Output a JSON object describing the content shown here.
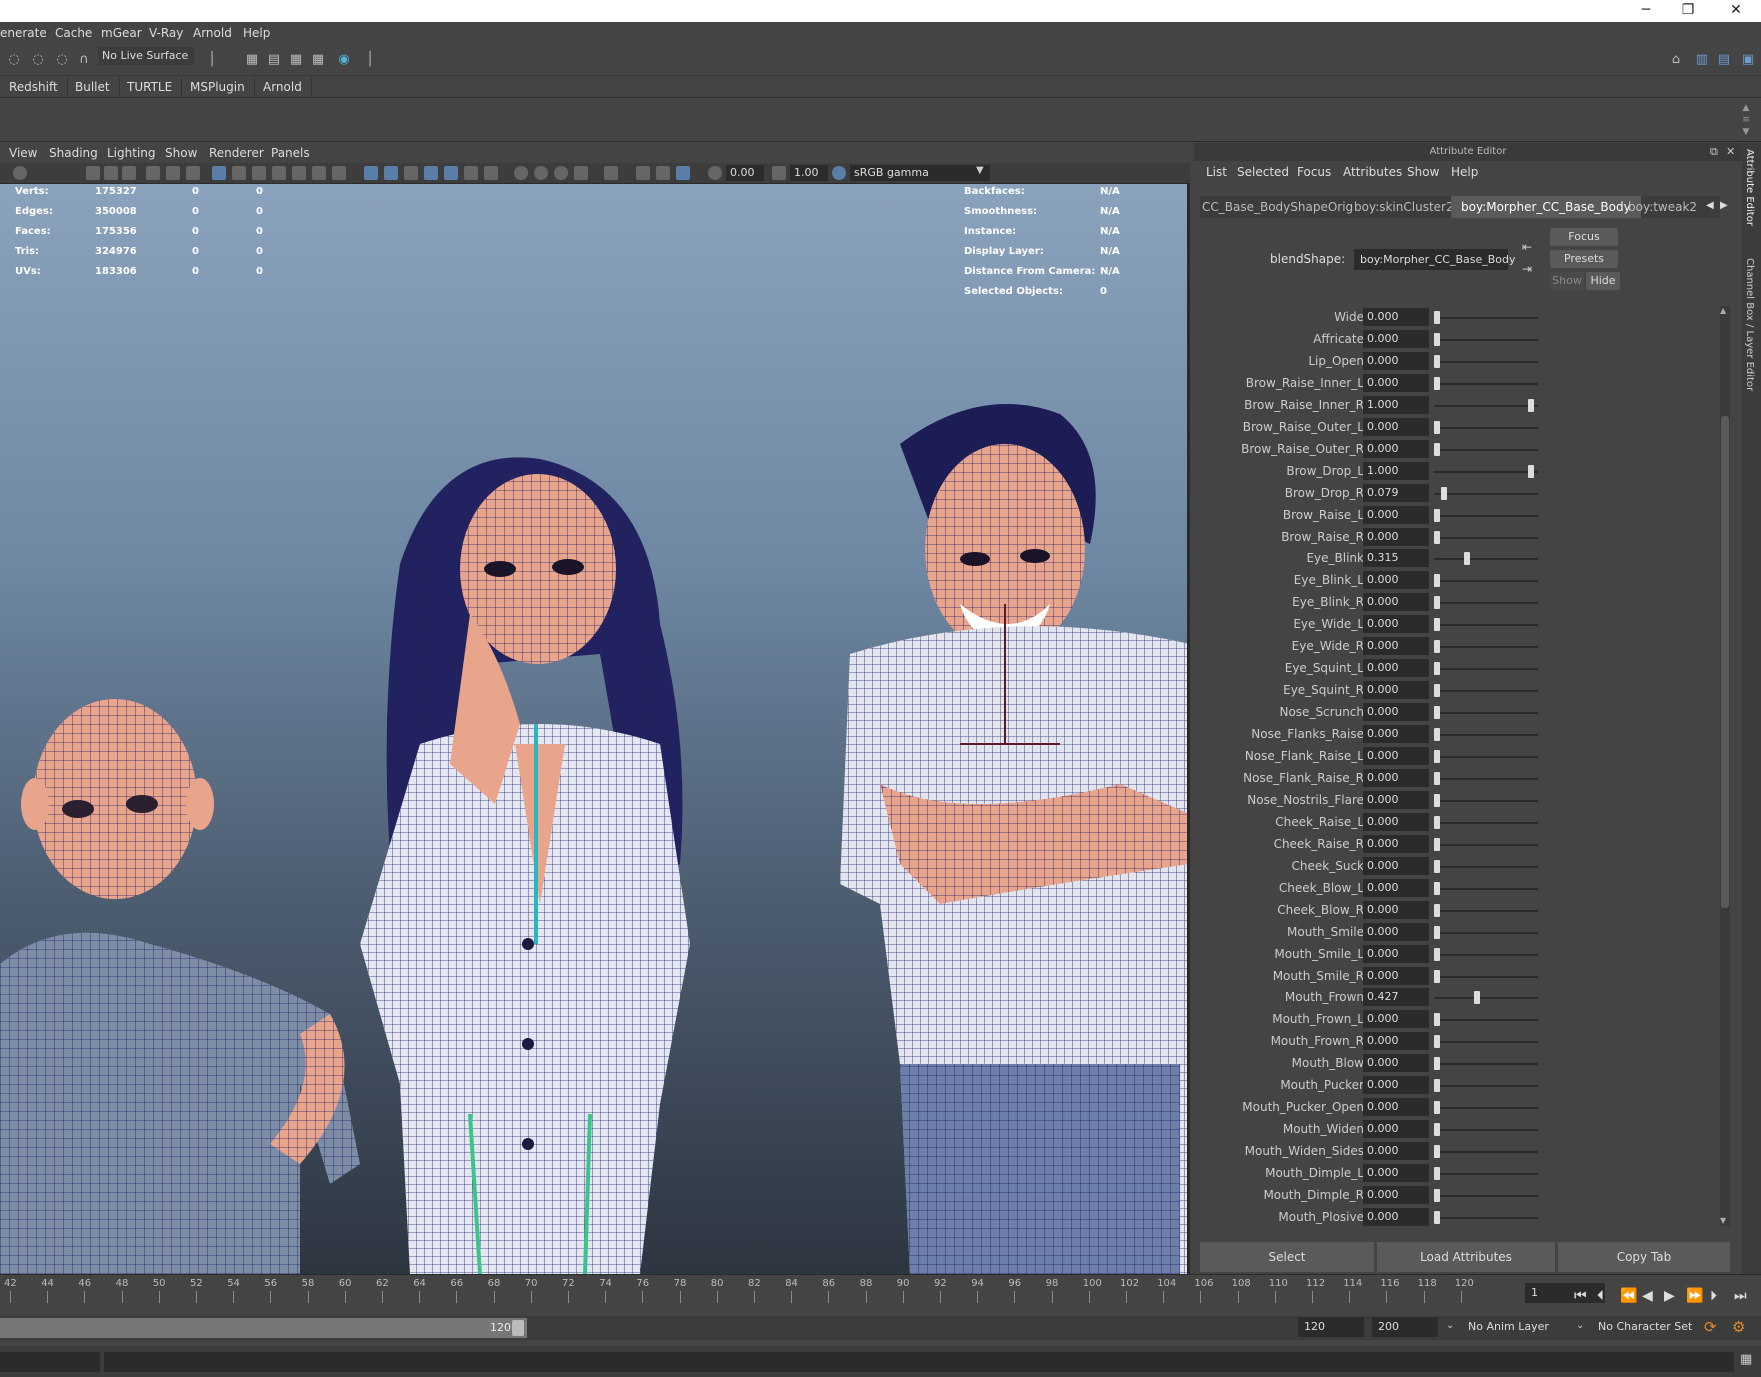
{
  "menu": [
    "enerate",
    "Cache",
    "mGear",
    "V-Ray",
    "Arnold",
    "Help"
  ],
  "toolbar": {
    "live_surface": "No Live Surface"
  },
  "shelf_tabs": [
    "Redshift",
    "Bullet",
    "TURTLE",
    "MSPlugin",
    "Arnold"
  ],
  "viewport": {
    "menu": [
      "View",
      "Shading",
      "Lighting",
      "Show",
      "Renderer",
      "Panels"
    ],
    "exposure": "0.00",
    "gamma": "1.00",
    "color_space": "sRGB gamma"
  },
  "hud_left": [
    {
      "label": "Verts:",
      "v1": "175327",
      "v2": "0",
      "v3": "0"
    },
    {
      "label": "Edges:",
      "v1": "350008",
      "v2": "0",
      "v3": "0"
    },
    {
      "label": "Faces:",
      "v1": "175356",
      "v2": "0",
      "v3": "0"
    },
    {
      "label": "Tris:",
      "v1": "324976",
      "v2": "0",
      "v3": "0"
    },
    {
      "label": "UVs:",
      "v1": "183306",
      "v2": "0",
      "v3": "0"
    }
  ],
  "hud_right": [
    {
      "label": "Backfaces:",
      "value": "N/A"
    },
    {
      "label": "Smoothness:",
      "value": "N/A"
    },
    {
      "label": "Instance:",
      "value": "N/A"
    },
    {
      "label": "Display Layer:",
      "value": "N/A"
    },
    {
      "label": "Distance From Camera:",
      "value": "N/A"
    },
    {
      "label": "Selected Objects:",
      "value": "0"
    }
  ],
  "attr_editor": {
    "title": "Attribute Editor",
    "menu": [
      "List",
      "Selected",
      "Focus",
      "Attributes",
      "Show",
      "Help"
    ],
    "tabs": [
      "CC_Base_BodyShapeOrig",
      "boy:skinCluster2",
      "boy:Morpher_CC_Base_Body",
      "boy:tweak2"
    ],
    "blendshape_label": "blendShape:",
    "blendshape_value": "boy:Morpher_CC_Base_Body",
    "focus": "Focus",
    "presets": "Presets",
    "show": "Show",
    "hide": "Hide",
    "select": "Select",
    "load_attributes": "Load Attributes",
    "copy_tab": "Copy Tab"
  },
  "attributes": [
    {
      "name": "Wide",
      "value": "0.000",
      "level": 0
    },
    {
      "name": "Affricate",
      "value": "0.000",
      "level": 0
    },
    {
      "name": "Lip_Open",
      "value": "0.000",
      "level": 0
    },
    {
      "name": "Brow_Raise_Inner_L",
      "value": "0.000",
      "level": 0
    },
    {
      "name": "Brow_Raise_Inner_R",
      "value": "1.000",
      "level": 1
    },
    {
      "name": "Brow_Raise_Outer_L",
      "value": "0.000",
      "level": 0
    },
    {
      "name": "Brow_Raise_Outer_R",
      "value": "0.000",
      "level": 0
    },
    {
      "name": "Brow_Drop_L",
      "value": "1.000",
      "level": 1
    },
    {
      "name": "Brow_Drop_R",
      "value": "0.079",
      "level": 0.079
    },
    {
      "name": "Brow_Raise_L",
      "value": "0.000",
      "level": 0
    },
    {
      "name": "Brow_Raise_R",
      "value": "0.000",
      "level": 0
    },
    {
      "name": "Eye_Blink",
      "value": "0.315",
      "level": 0.315
    },
    {
      "name": "Eye_Blink_L",
      "value": "0.000",
      "level": 0
    },
    {
      "name": "Eye_Blink_R",
      "value": "0.000",
      "level": 0
    },
    {
      "name": "Eye_Wide_L",
      "value": "0.000",
      "level": 0
    },
    {
      "name": "Eye_Wide_R",
      "value": "0.000",
      "level": 0
    },
    {
      "name": "Eye_Squint_L",
      "value": "0.000",
      "level": 0
    },
    {
      "name": "Eye_Squint_R",
      "value": "0.000",
      "level": 0
    },
    {
      "name": "Nose_Scrunch",
      "value": "0.000",
      "level": 0
    },
    {
      "name": "Nose_Flanks_Raise",
      "value": "0.000",
      "level": 0
    },
    {
      "name": "Nose_Flank_Raise_L",
      "value": "0.000",
      "level": 0
    },
    {
      "name": "Nose_Flank_Raise_R",
      "value": "0.000",
      "level": 0
    },
    {
      "name": "Nose_Nostrils_Flare",
      "value": "0.000",
      "level": 0
    },
    {
      "name": "Cheek_Raise_L",
      "value": "0.000",
      "level": 0
    },
    {
      "name": "Cheek_Raise_R",
      "value": "0.000",
      "level": 0
    },
    {
      "name": "Cheek_Suck",
      "value": "0.000",
      "level": 0
    },
    {
      "name": "Cheek_Blow_L",
      "value": "0.000",
      "level": 0
    },
    {
      "name": "Cheek_Blow_R",
      "value": "0.000",
      "level": 0
    },
    {
      "name": "Mouth_Smile",
      "value": "0.000",
      "level": 0
    },
    {
      "name": "Mouth_Smile_L",
      "value": "0.000",
      "level": 0
    },
    {
      "name": "Mouth_Smile_R",
      "value": "0.000",
      "level": 0
    },
    {
      "name": "Mouth_Frown",
      "value": "0.427",
      "level": 0.427
    },
    {
      "name": "Mouth_Frown_L",
      "value": "0.000",
      "level": 0
    },
    {
      "name": "Mouth_Frown_R",
      "value": "0.000",
      "level": 0
    },
    {
      "name": "Mouth_Blow",
      "value": "0.000",
      "level": 0
    },
    {
      "name": "Mouth_Pucker",
      "value": "0.000",
      "level": 0
    },
    {
      "name": "Mouth_Pucker_Open",
      "value": "0.000",
      "level": 0
    },
    {
      "name": "Mouth_Widen",
      "value": "0.000",
      "level": 0
    },
    {
      "name": "Mouth_Widen_Sides",
      "value": "0.000",
      "level": 0
    },
    {
      "name": "Mouth_Dimple_L",
      "value": "0.000",
      "level": 0
    },
    {
      "name": "Mouth_Dimple_R",
      "value": "0.000",
      "level": 0
    },
    {
      "name": "Mouth_Plosive",
      "value": "0.000",
      "level": 0
    }
  ],
  "side_tabs": [
    "Attribute Editor",
    "Channel Box / Layer Editor"
  ],
  "timeline": {
    "ticks": [
      "42",
      "44",
      "46",
      "48",
      "50",
      "52",
      "54",
      "56",
      "58",
      "60",
      "62",
      "64",
      "66",
      "68",
      "70",
      "72",
      "74",
      "76",
      "78",
      "80",
      "82",
      "84",
      "86",
      "88",
      "90",
      "92",
      "94",
      "96",
      "98",
      "100",
      "102",
      "104",
      "106",
      "108",
      "110",
      "112",
      "114",
      "116",
      "118",
      "120"
    ],
    "current_frame": "1"
  },
  "range": {
    "end_marker": "120",
    "range_end": "120",
    "anim_end": "200",
    "anim_layer": "No Anim Layer",
    "character_set": "No Character Set"
  }
}
